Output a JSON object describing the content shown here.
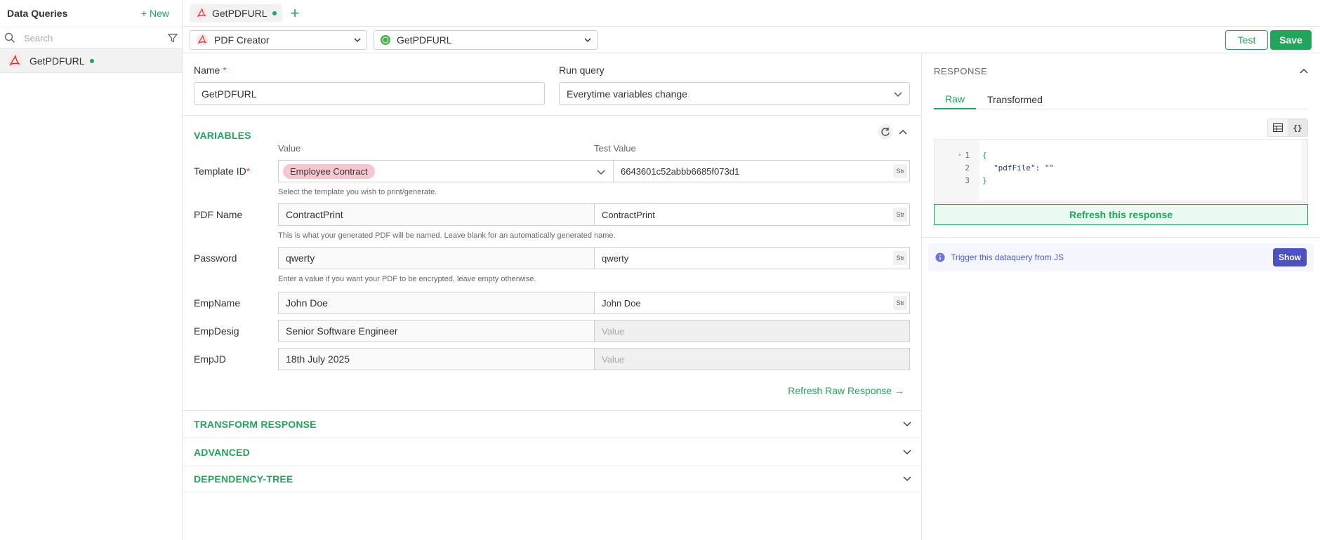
{
  "sidebar": {
    "title": "Data Queries",
    "new_label": "+ New",
    "search_placeholder": "Search",
    "items": [
      {
        "label": "GetPDFURL"
      }
    ]
  },
  "tabbar": {
    "tab_label": "GetPDFURL",
    "add_label": "+"
  },
  "toolbar": {
    "datasource_label": "PDF Creator",
    "query_label": "GetPDFURL",
    "test_label": "Test",
    "save_label": "Save"
  },
  "form": {
    "name_label": "Name",
    "name_required": "*",
    "name_value": "GetPDFURL",
    "run_query_label": "Run query",
    "run_query_value": "Everytime variables change"
  },
  "variables": {
    "title": "VARIABLES",
    "col_value": "Value",
    "col_test": "Test Value",
    "rows": [
      {
        "label": "Template ID",
        "required": "*",
        "chip": "Employee Contract",
        "test": "6643601c52abbb6685f073d1",
        "type": "Str",
        "hint": "Select the template you wish to print/generate."
      },
      {
        "label": "PDF Name",
        "value": "ContractPrint",
        "test": "ContractPrint",
        "type": "Str",
        "hint": "This is what your generated PDF will be named. Leave blank for an automatically generated name."
      },
      {
        "label": "Password",
        "value": "qwerty",
        "test": "qwerty",
        "type": "Str",
        "hint": "Enter a value if you want your PDF to be encrypted, leave empty otherwise."
      },
      {
        "label": "EmpName",
        "value": "John Doe",
        "test": "John Doe",
        "type": "Str"
      },
      {
        "label": "EmpDesig",
        "value": "Senior Software Engineer",
        "test_placeholder": "Value"
      },
      {
        "label": "EmpJD",
        "value": "18th July 2025",
        "test_placeholder": "Value"
      }
    ],
    "refresh_label": "Refresh Raw Response →"
  },
  "sections": {
    "transform": "TRANSFORM RESPONSE",
    "advanced": "ADVANCED",
    "dependency": "DEPENDENCY-TREE"
  },
  "response": {
    "title": "RESPONSE",
    "tabs": [
      "Raw",
      "Transformed"
    ],
    "code_lines": [
      "{",
      "\"pdfFile\": \"\"",
      "}"
    ],
    "line_numbers": [
      "1",
      "2",
      "3"
    ],
    "refresh_label": "Refresh this response",
    "trigger_text": "Trigger this dataquery from JS",
    "show_label": "Show"
  },
  "colors": {
    "accent": "#22a55b",
    "chip_bg": "#f7c6cf",
    "trigger_bg": "#f5f6ff",
    "show_bg": "#4c51bf"
  }
}
